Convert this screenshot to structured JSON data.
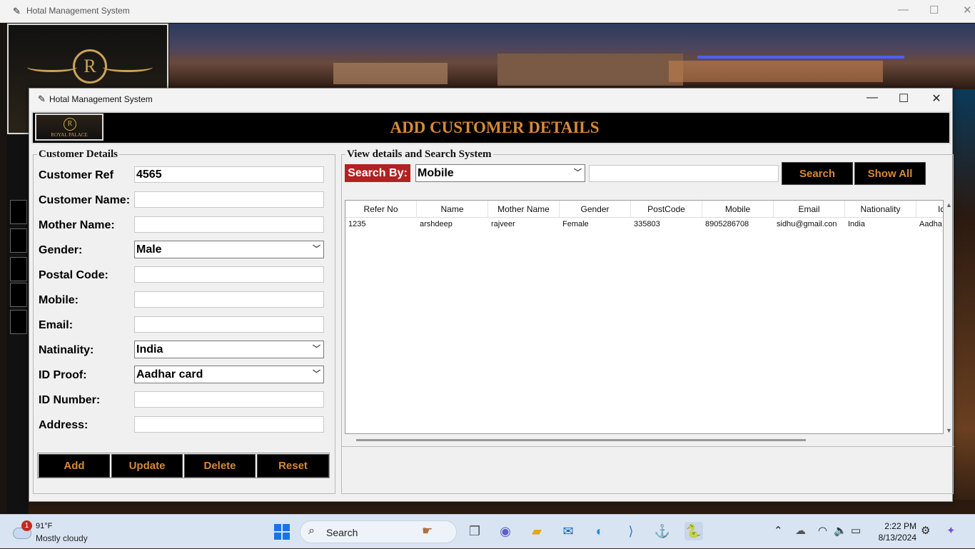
{
  "bg_window": {
    "title": "Hotal Management System",
    "minimize": "—",
    "maximize": "☐",
    "close": "✕"
  },
  "window": {
    "title": "Hotal Management System",
    "minimize": "—",
    "maximize": "☐",
    "close": "✕"
  },
  "header": {
    "title": "ADD CUSTOMER DETAILS",
    "logo_letter": "R",
    "logo_text": "ROYAL PALACE"
  },
  "customer_form": {
    "legend": "Customer Details",
    "fields": [
      {
        "label": "Customer Ref",
        "value": "4565",
        "type": "entry"
      },
      {
        "label": "Customer Name:",
        "value": "",
        "type": "entry"
      },
      {
        "label": "Mother Name:",
        "value": "",
        "type": "entry"
      },
      {
        "label": "Gender:",
        "value": "Male",
        "type": "combo"
      },
      {
        "label": "Postal Code:",
        "value": "",
        "type": "entry"
      },
      {
        "label": "Mobile:",
        "value": "",
        "type": "entry"
      },
      {
        "label": "Email:",
        "value": "",
        "type": "entry"
      },
      {
        "label": "Natinality:",
        "value": "India",
        "type": "combo"
      },
      {
        "label": "ID Proof:",
        "value": "Aadhar card",
        "type": "combo"
      },
      {
        "label": "ID Number:",
        "value": "",
        "type": "entry"
      },
      {
        "label": "Address:",
        "value": "",
        "type": "entry"
      }
    ],
    "buttons": {
      "add": "Add",
      "update": "Update",
      "delete": "Delete",
      "reset": "Reset"
    }
  },
  "search_panel": {
    "legend": "View details and Search System",
    "search_by_label": "Search By:",
    "search_by_value": "Mobile",
    "search_text": "",
    "search_button": "Search",
    "show_all_button": "Show All"
  },
  "table": {
    "columns": [
      "Refer No",
      "Name",
      "Mother Name",
      "Gender",
      "PostCode",
      "Mobile",
      "Email",
      "Nationality",
      "Id"
    ],
    "rows": [
      [
        "1235",
        "arshdeep",
        "rajveer",
        "Female",
        "335803",
        "8905286708",
        "sidhu@gmail.con",
        "India",
        "Aadha"
      ]
    ]
  },
  "taskbar": {
    "weather_badge": "1",
    "weather_temp": "91°F",
    "weather_desc": "Mostly cloudy",
    "search_placeholder": "Search",
    "time": "2:22 PM",
    "date": "8/13/2024"
  },
  "colors": {
    "accent_orange": "#d68a38",
    "search_label_red": "#b22222",
    "header_bg": "#000000"
  }
}
